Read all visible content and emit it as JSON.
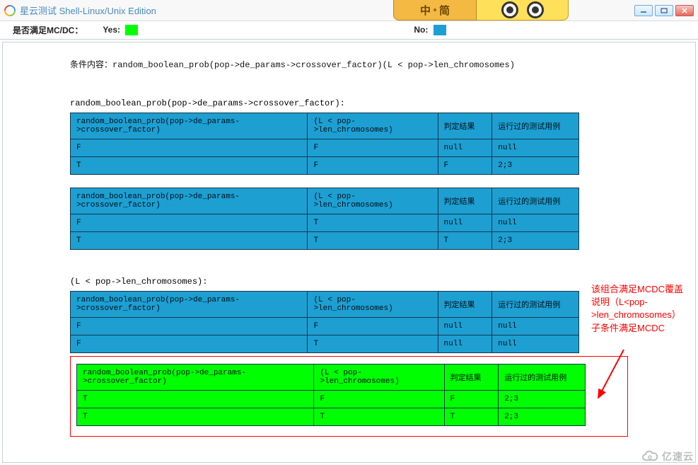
{
  "window": {
    "title": "星云测试 Shell-Linux/Unix Edition"
  },
  "ime": {
    "left_char": "中",
    "right_char": "简"
  },
  "legend": {
    "question": "是否满足MC/DC：",
    "yes_label": "Yes:",
    "no_label": "No:"
  },
  "condition": {
    "label": "条件内容：",
    "expr": "random_boolean_prob(pop->de_params->crossover_factor)(L < pop->len_chromosomes)"
  },
  "headers": {
    "c1": "random_boolean_prob(pop->de_params->crossover_factor)",
    "c2": "(L < pop->len_chromosomes)",
    "c3": "判定结果",
    "c4": "运行过的测试用例"
  },
  "section1": {
    "title": "random_boolean_prob(pop->de_params->crossover_factor):",
    "tableA": [
      {
        "c1": "F",
        "c2": "F",
        "c3": "null",
        "c4": "null"
      },
      {
        "c1": "T",
        "c2": "F",
        "c3": "F",
        "c4": "2;3"
      }
    ],
    "tableB": [
      {
        "c1": "F",
        "c2": "T",
        "c3": "null",
        "c4": "null"
      },
      {
        "c1": "T",
        "c2": "T",
        "c3": "T",
        "c4": "2;3"
      }
    ]
  },
  "section2": {
    "title": "(L < pop->len_chromosomes):",
    "tableA": [
      {
        "c1": "F",
        "c2": "F",
        "c3": "null",
        "c4": "null"
      },
      {
        "c1": "F",
        "c2": "T",
        "c3": "null",
        "c4": "null"
      }
    ],
    "tableB": [
      {
        "c1": "T",
        "c2": "F",
        "c3": "F",
        "c4": "2;3"
      },
      {
        "c1": "T",
        "c2": "T",
        "c3": "T",
        "c4": "2;3"
      }
    ]
  },
  "annotation": {
    "line1": "该组合满足MCDC覆盖",
    "line2": "说明（L<pop-",
    "line3": ">len_chromosomes）",
    "line4": "子条件满足MCDC"
  },
  "watermark": "亿速云"
}
